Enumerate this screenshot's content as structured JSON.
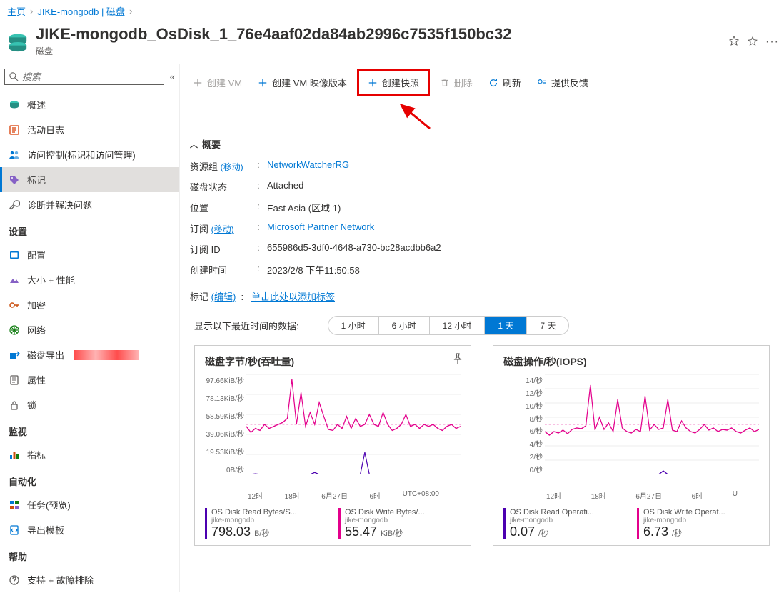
{
  "breadcrumb": {
    "home": "主页",
    "parent": "JIKE-mongodb | 磁盘"
  },
  "page": {
    "title": "JIKE-mongodb_OsDisk_1_76e4aaf02da84ab2996c7535f150bc32",
    "subtitle": "磁盘"
  },
  "search": {
    "placeholder": "搜索"
  },
  "sidebar": {
    "items_main": [
      {
        "label": "概述",
        "icon": "disk"
      },
      {
        "label": "活动日志",
        "icon": "log"
      },
      {
        "label": "访问控制(标识和访问管理)",
        "icon": "people"
      },
      {
        "label": "标记",
        "icon": "tag"
      },
      {
        "label": "诊断并解决问题",
        "icon": "wrench"
      }
    ],
    "section_settings": "设置",
    "items_settings": [
      {
        "label": "配置",
        "icon": "config"
      },
      {
        "label": "大小 + 性能",
        "icon": "size"
      },
      {
        "label": "加密",
        "icon": "key"
      },
      {
        "label": "网络",
        "icon": "net"
      },
      {
        "label": "磁盘导出",
        "icon": "export",
        "redacted": true
      },
      {
        "label": "属性",
        "icon": "props"
      },
      {
        "label": "锁",
        "icon": "lock"
      }
    ],
    "section_monitor": "监视",
    "items_monitor": [
      {
        "label": "指标",
        "icon": "metrics"
      }
    ],
    "section_auto": "自动化",
    "items_auto": [
      {
        "label": "任务(预览)",
        "icon": "tasks"
      },
      {
        "label": "导出模板",
        "icon": "template"
      }
    ],
    "section_help": "帮助",
    "items_help": [
      {
        "label": "支持 + 故障排除",
        "icon": "help"
      }
    ]
  },
  "toolbar": {
    "create_vm": "创建 VM",
    "create_image": "创建 VM 映像版本",
    "create_snapshot": "创建快照",
    "delete": "删除",
    "refresh": "刷新",
    "feedback": "提供反馈"
  },
  "overview": {
    "header": "概要",
    "rows": {
      "resource_group_k": "资源组",
      "move": "(移动)",
      "resource_group_v": "NetworkWatcherRG",
      "disk_state_k": "磁盘状态",
      "disk_state_v": "Attached",
      "location_k": "位置",
      "location_v": "East Asia (区域 1)",
      "subscription_k": "订阅",
      "subscription_v": "Microsoft Partner Network",
      "subscription_id_k": "订阅 ID",
      "subscription_id_v": "655986d5-3df0-4648-a730-bc28acdbb6a2",
      "created_k": "创建时间",
      "created_v": "2023/2/8 下午11:50:58"
    }
  },
  "tags": {
    "label": "标记",
    "edit": "(编辑)",
    "add_link": "单击此处以添加标签"
  },
  "time_filter": {
    "label": "显示以下最近时间的数据:",
    "options": [
      "1 小时",
      "6 小时",
      "12 小时",
      "1 天",
      "7 天"
    ],
    "active_index": 3
  },
  "chart_data": [
    {
      "type": "line",
      "title": "磁盘字节/秒(吞吐量)",
      "ylabel_unit": "KiB/秒",
      "y_ticks": [
        "97.66KiB/秒",
        "78.13KiB/秒",
        "58.59KiB/秒",
        "39.06KiB/秒",
        "19.53KiB/秒",
        "0B/秒"
      ],
      "x_ticks": [
        "12时",
        "18时",
        "6月27日",
        "6时",
        "UTC+08:00"
      ],
      "series": [
        {
          "name": "OS Disk Read Bytes/S...",
          "sub": "jike-mongodb",
          "value": "798.03",
          "unit": "B/秒",
          "color": "#4c00b0",
          "values": [
            0,
            0,
            0.5,
            0,
            0,
            0,
            0,
            0,
            0,
            0,
            0,
            0,
            0,
            0,
            0,
            2,
            0,
            0,
            0,
            0,
            0,
            0,
            0,
            0,
            0,
            0,
            22,
            0,
            0,
            0,
            0,
            0,
            0,
            0,
            0,
            0,
            0,
            0,
            0,
            0,
            0,
            0,
            0,
            0,
            0,
            0,
            0,
            0
          ]
        },
        {
          "name": "OS Disk Write Bytes/...",
          "sub": "jike-mongodb",
          "value": "55.47",
          "unit": "KiB/秒",
          "color": "#e3008c",
          "values": [
            48,
            42,
            46,
            44,
            50,
            46,
            48,
            50,
            52,
            56,
            95,
            50,
            82,
            48,
            62,
            50,
            72,
            58,
            45,
            44,
            50,
            46,
            58,
            46,
            56,
            48,
            50,
            60,
            50,
            48,
            62,
            50,
            44,
            46,
            50,
            60,
            48,
            50,
            46,
            50,
            48,
            50,
            46,
            44,
            48,
            50,
            46,
            48
          ]
        }
      ]
    },
    {
      "type": "line",
      "title": "磁盘操作/秒(IOPS)",
      "ylabel_unit": "/秒",
      "y_ticks": [
        "14/秒",
        "12/秒",
        "10/秒",
        "8/秒",
        "6/秒",
        "4/秒",
        "2/秒",
        "0/秒"
      ],
      "x_ticks": [
        "12时",
        "18时",
        "6月27日",
        "6时",
        "U"
      ],
      "series": [
        {
          "name": "OS Disk Read Operati...",
          "sub": "jike-mongodb",
          "value": "0.07",
          "unit": "/秒",
          "color": "#4c00b0",
          "values": [
            0,
            0,
            0,
            0,
            0,
            0,
            0,
            0,
            0,
            0,
            0,
            0,
            0,
            0,
            0,
            0,
            0,
            0,
            0,
            0,
            0,
            0,
            0,
            0,
            0,
            0,
            0.5,
            0,
            0,
            0,
            0,
            0,
            0,
            0,
            0,
            0,
            0,
            0,
            0,
            0,
            0,
            0,
            0,
            0,
            0,
            0,
            0,
            0
          ]
        },
        {
          "name": "OS Disk Write Operat...",
          "sub": "jike-mongodb",
          "value": "6.73",
          "unit": "/秒",
          "color": "#e3008c",
          "values": [
            6,
            5.5,
            6,
            5.8,
            6.2,
            5.7,
            6.3,
            6.5,
            6.4,
            6.8,
            12.5,
            6.2,
            8,
            6.3,
            7.2,
            6,
            10.5,
            6.5,
            6,
            5.8,
            6.3,
            6,
            11,
            6.2,
            7,
            6.3,
            6.5,
            10.5,
            6.2,
            6,
            7.5,
            6.5,
            6,
            5.8,
            6.3,
            7,
            6.2,
            6.5,
            6,
            6.3,
            6.2,
            6.5,
            6,
            5.8,
            6.2,
            6.5,
            6,
            6.3
          ]
        }
      ]
    }
  ]
}
